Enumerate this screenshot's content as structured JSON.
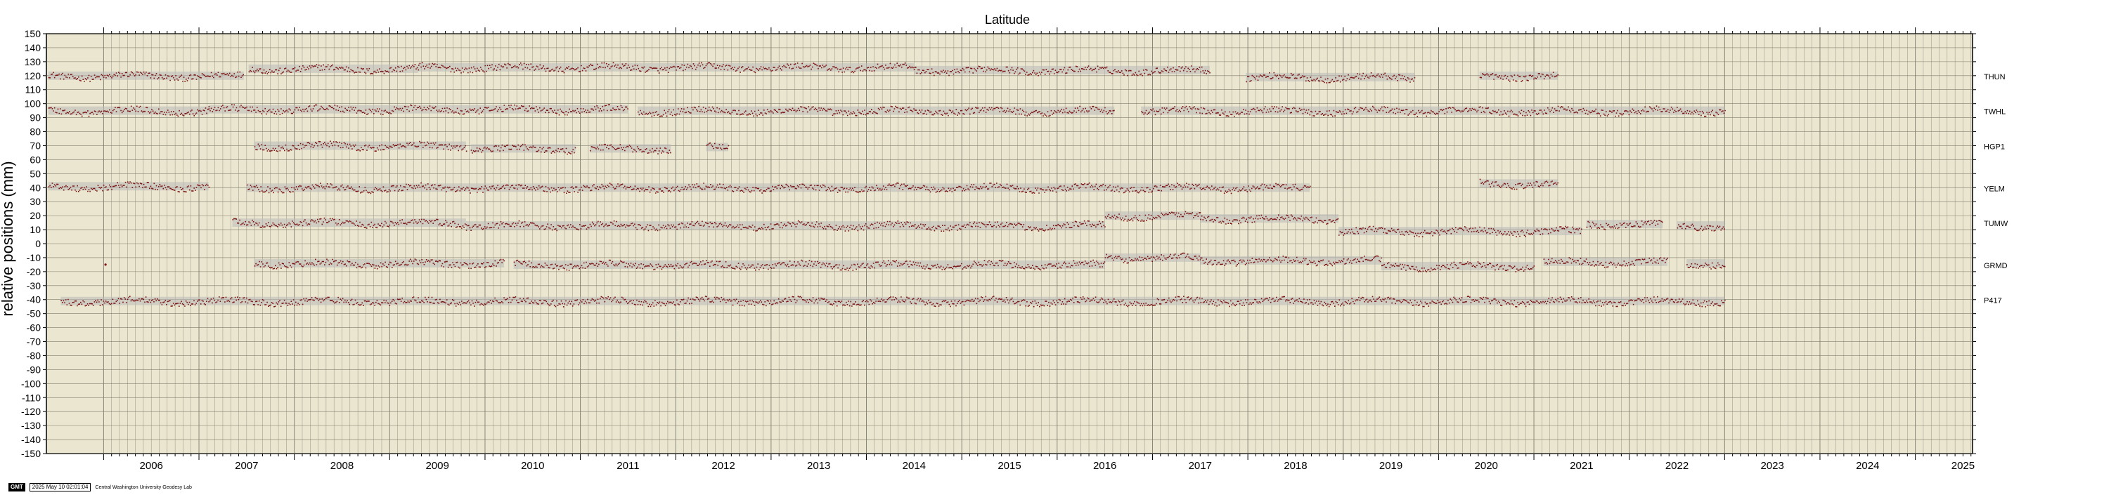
{
  "chart_data": {
    "type": "scatter",
    "title": "Latitude",
    "ylabel": "relative positions (mm)",
    "xlabel": "",
    "xlim": [
      2005.4,
      2025.6
    ],
    "ylim": [
      -150,
      150
    ],
    "ytick_step": 10,
    "x_tick_labels": [
      "2006",
      "2007",
      "2008",
      "2009",
      "2010",
      "2011",
      "2012",
      "2013",
      "2014",
      "2015",
      "2016",
      "2017",
      "2018",
      "2019",
      "2020",
      "2021",
      "2022",
      "2023",
      "2024",
      "2025"
    ],
    "grid": true,
    "colors": {
      "background": "#ebe6cf",
      "points": "#7a1212",
      "error_band": "#b9b9b9",
      "grid": "#807c6e"
    },
    "series": [
      {
        "name": "THUN",
        "offset": 120,
        "segments": [
          [
            2005.42,
            2007.47,
            120
          ],
          [
            2007.52,
            2009.3,
            125
          ],
          [
            2009.3,
            2014.5,
            126
          ],
          [
            2014.5,
            2017.6,
            124
          ],
          [
            2017.98,
            2019.75,
            119
          ],
          [
            2020.43,
            2021.25,
            120
          ]
        ]
      },
      {
        "name": "TWHL",
        "offset": 95,
        "segments": [
          [
            2005.42,
            2007.1,
            95
          ],
          [
            2007.1,
            2011.5,
            96
          ],
          [
            2011.6,
            2016.6,
            95
          ],
          [
            2016.88,
            2023.0,
            95
          ]
        ]
      },
      {
        "name": "HGP1",
        "offset": 70,
        "segments": [
          [
            2007.58,
            2009.8,
            70
          ],
          [
            2009.85,
            2010.95,
            68
          ],
          [
            2011.1,
            2011.95,
            68
          ],
          [
            2012.32,
            2012.55,
            69
          ]
        ]
      },
      {
        "name": "YELM",
        "offset": 40,
        "segments": [
          [
            2005.42,
            2007.1,
            41
          ],
          [
            2007.5,
            2018.65,
            40
          ],
          [
            2020.43,
            2021.25,
            43
          ]
        ]
      },
      {
        "name": "TUMW",
        "offset": 15,
        "segments": [
          [
            2007.35,
            2009.8,
            15
          ],
          [
            2009.8,
            2016.5,
            13
          ],
          [
            2016.5,
            2017.5,
            20
          ],
          [
            2017.5,
            2018.95,
            18
          ],
          [
            2018.95,
            2021.5,
            9
          ],
          [
            2021.55,
            2022.35,
            14
          ],
          [
            2022.5,
            2023.0,
            13
          ]
        ]
      },
      {
        "name": "GRMD",
        "offset": -15,
        "segments": [
          [
            2007.58,
            2010.2,
            -14
          ],
          [
            2010.3,
            2016.5,
            -15
          ],
          [
            2016.5,
            2017.5,
            -10
          ],
          [
            2017.5,
            2019.4,
            -12
          ],
          [
            2019.4,
            2021.0,
            -16
          ],
          [
            2021.1,
            2022.4,
            -13
          ],
          [
            2022.6,
            2023.0,
            -14
          ]
        ]
      },
      {
        "name": "P417",
        "offset": -40,
        "segments": [
          [
            2005.55,
            2023.0,
            -41
          ]
        ]
      }
    ],
    "outliers": [
      [
        2006.02,
        -15
      ]
    ]
  },
  "footer": {
    "badge": "GMT",
    "timestamp": "2025 May 10 02:01:04",
    "credit": "Central Washington University Geodesy Lab"
  }
}
